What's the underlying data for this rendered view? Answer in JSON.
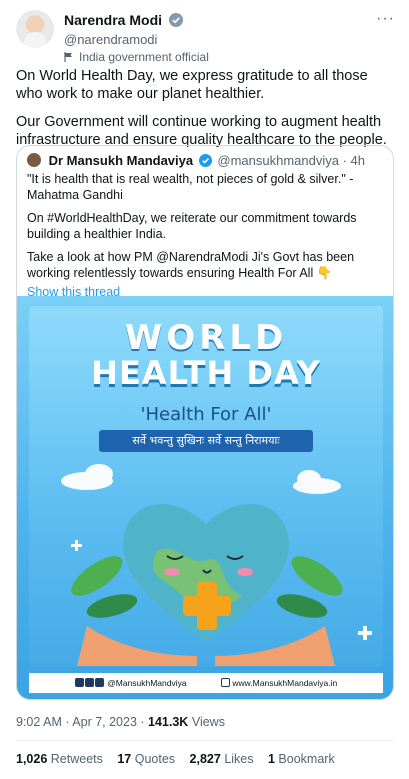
{
  "author": {
    "name": "Narendra Modi",
    "handle": "@narendramodi",
    "label": "India government official"
  },
  "more_label": "···",
  "body": [
    "On World Health Day, we express gratitude to all those who work to make our planet healthier.",
    "Our Government will continue working to augment health infrastructure and ensure quality healthcare to the people."
  ],
  "quoted": {
    "name": "Dr Mansukh Mandaviya",
    "handle": "@mansukhmandviya",
    "time": "· 4h",
    "text": [
      "\"It is health that is real wealth, not pieces of gold & silver.\" - Mahatma Gandhi",
      "On #WorldHealthDay, we reiterate our commitment towards building a healthier India.",
      "Take a look at how PM @NarendraModi Ji's Govt has been working relentlessly towards ensuring Health For All 👇"
    ],
    "show_thread": "Show this thread",
    "image": {
      "title_line1": "WORLD",
      "title_line2": "HEALTH DAY",
      "tagline": "'Health For All'",
      "sanskrit": "सर्वे भवन्तु सुखिनः सर्वे सन्तु निरामयाः",
      "footer_social": "@MansukhMandviya",
      "footer_web": "www.MansukhMandaviya.in"
    }
  },
  "meta": {
    "time": "9:02 AM · Apr 7, 2023 ·",
    "views_count": "141.3K",
    "views_label": "Views"
  },
  "stats": {
    "retweets_count": "1,026",
    "retweets_label": "Retweets",
    "quotes_count": "17",
    "quotes_label": "Quotes",
    "likes_count": "2,827",
    "likes_label": "Likes",
    "bookmarks_count": "1",
    "bookmarks_label": "Bookmark"
  },
  "colors": {
    "verified": "#1d9bf0",
    "link": "#1d9bf0",
    "muted": "#536471"
  }
}
